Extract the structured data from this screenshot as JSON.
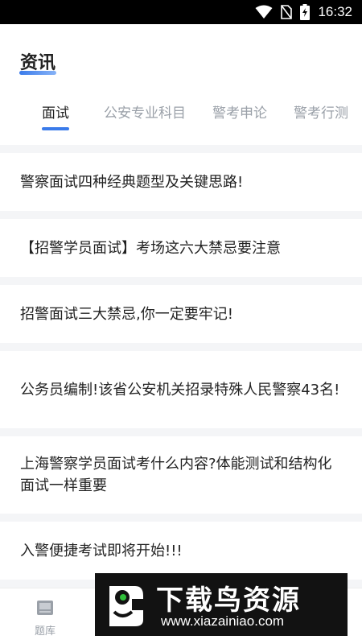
{
  "status_bar": {
    "time": "16:32"
  },
  "header": {
    "title": "资讯"
  },
  "tabs": [
    {
      "label": "面试",
      "active": true
    },
    {
      "label": "公安专业科目",
      "active": false
    },
    {
      "label": "警考申论",
      "active": false
    },
    {
      "label": "警考行测",
      "active": false
    }
  ],
  "articles": [
    {
      "title": "警察面试四种经典题型及关键思路!"
    },
    {
      "title": "【招警学员面试】考场这六大禁忌要注意"
    },
    {
      "title": "招警面试三大禁忌,你一定要牢记!"
    },
    {
      "title": "公务员编制!该省公安机关招录特殊人民警察43名!"
    },
    {
      "title": "上海警察学员面试考什么内容?体能测试和结构化面试一样重要"
    },
    {
      "title": "入警便捷考试即将开始!!!"
    }
  ],
  "bottom_nav": {
    "items": [
      {
        "label": "题库",
        "icon": "question-bank-icon"
      }
    ]
  },
  "watermark": {
    "title": "下载鸟资源",
    "url": "www.xiazainiao.com"
  },
  "colors": {
    "accent": "#3a7bea",
    "muted": "#9aa0a8",
    "text": "#222222",
    "background": "#f4f5f7"
  }
}
